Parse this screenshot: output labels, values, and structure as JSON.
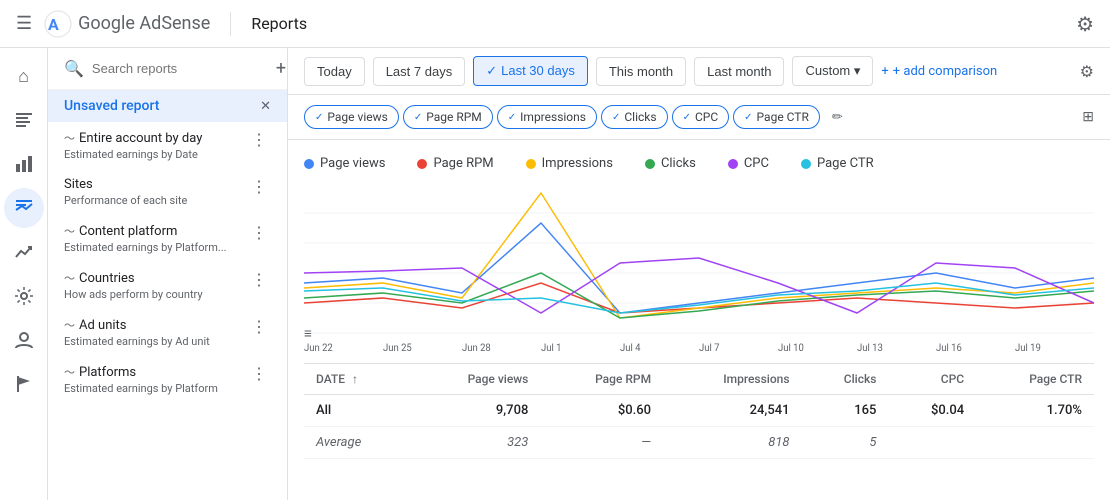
{
  "app": {
    "logo_text": "Google AdSense",
    "page_title": "Reports",
    "settings_icon": "⚙"
  },
  "filter_bar": {
    "buttons": [
      {
        "label": "Today",
        "active": false
      },
      {
        "label": "Last 7 days",
        "active": false
      },
      {
        "label": "Last 30 days",
        "active": true
      },
      {
        "label": "This month",
        "active": false
      },
      {
        "label": "Last month",
        "active": false
      }
    ],
    "custom_label": "Custom",
    "add_comparison_label": "+ add comparison"
  },
  "sidebar": {
    "search_placeholder": "Search reports",
    "active_item": "Unsaved report",
    "items": [
      {
        "title": "Entire account by day",
        "sub": "Estimated earnings by Date",
        "wave": true
      },
      {
        "title": "Sites",
        "sub": "Performance of each site",
        "wave": false
      },
      {
        "title": "Content platform",
        "sub": "Estimated earnings by Platform...",
        "wave": true
      },
      {
        "title": "Countries",
        "sub": "How ads perform by country",
        "wave": true
      },
      {
        "title": "Ad units",
        "sub": "Estimated earnings by Ad unit",
        "wave": true
      },
      {
        "title": "Platforms",
        "sub": "Estimated earnings by Platform",
        "wave": true
      }
    ]
  },
  "metrics": {
    "pills": [
      {
        "label": "Page views",
        "active": true
      },
      {
        "label": "Page RPM",
        "active": true
      },
      {
        "label": "Impressions",
        "active": true
      },
      {
        "label": "Clicks",
        "active": true
      },
      {
        "label": "CPC",
        "active": true
      },
      {
        "label": "Page CTR",
        "active": true
      }
    ]
  },
  "legend": [
    {
      "label": "Page views",
      "color": "#4285f4"
    },
    {
      "label": "Page RPM",
      "color": "#ea4335"
    },
    {
      "label": "Impressions",
      "color": "#fbbc04"
    },
    {
      "label": "Clicks",
      "color": "#34a853"
    },
    {
      "label": "CPC",
      "color": "#a142f4"
    },
    {
      "label": "Page CTR",
      "color": "#24c1e0"
    }
  ],
  "chart": {
    "x_labels": [
      "Jun 22",
      "Jun 25",
      "Jun 28",
      "Jul 1",
      "Jul 4",
      "Jul 7",
      "Jul 10",
      "Jul 13",
      "Jul 16",
      "Jul 19"
    ]
  },
  "table": {
    "headers": [
      "DATE",
      "Page views",
      "Page RPM",
      "Impressions",
      "Clicks",
      "CPC",
      "Page CTR"
    ],
    "rows": [
      {
        "label": "All",
        "values": [
          "9,708",
          "$0.60",
          "24,541",
          "165",
          "$0.04",
          "1.70%"
        ],
        "type": "all"
      },
      {
        "label": "Average",
        "values": [
          "323",
          "—",
          "818",
          "5",
          "",
          ""
        ],
        "type": "avg"
      }
    ]
  },
  "left_nav": {
    "icons": [
      {
        "name": "home",
        "symbol": "⌂",
        "active": false
      },
      {
        "name": "pages",
        "symbol": "☰",
        "active": false
      },
      {
        "name": "chart-bar",
        "symbol": "▦",
        "active": false
      },
      {
        "name": "reports-active",
        "symbol": "⚏",
        "active": true
      },
      {
        "name": "trending",
        "symbol": "↗",
        "active": false
      },
      {
        "name": "settings",
        "symbol": "⚙",
        "active": false
      },
      {
        "name": "person",
        "symbol": "👤",
        "active": false
      },
      {
        "name": "flag",
        "symbol": "⚑",
        "active": false
      }
    ]
  }
}
